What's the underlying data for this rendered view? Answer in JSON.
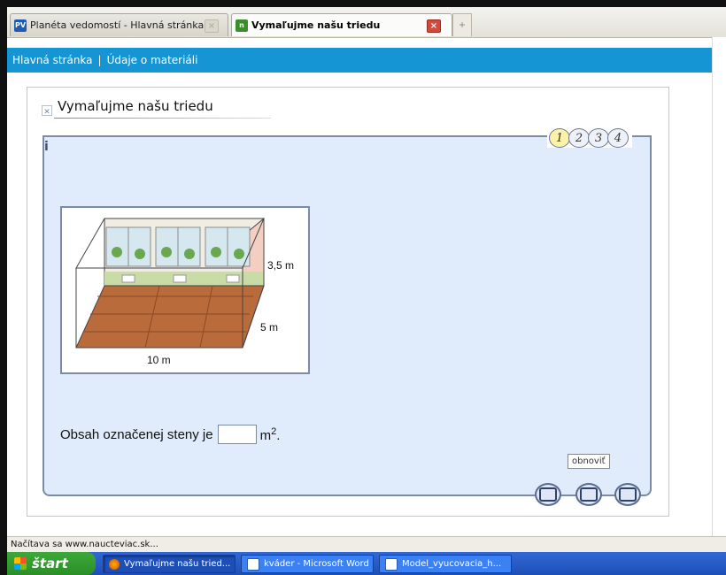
{
  "tabs": [
    {
      "favicon": "PV",
      "label": "Planéta vedomostí - Hlavná stránka",
      "close": "×"
    },
    {
      "favicon": "n",
      "label": "Vymaľujme našu triedu",
      "close": "×"
    }
  ],
  "new_tab": "+",
  "nav": {
    "home": "Hlavná stránka",
    "separator": "|",
    "details": "Údaje o materiáli"
  },
  "card": {
    "title": "Vymaľujme našu triedu",
    "info": "i"
  },
  "steps": [
    "1",
    "2",
    "3",
    "4"
  ],
  "active_step": 1,
  "illustration": {
    "height_label": "3,5 m",
    "depth_label": "5 m",
    "width_label": "10 m"
  },
  "question": {
    "text": "Obsah označenej steny je",
    "unit": "m",
    "exponent": "2",
    "period": ".",
    "answer": ""
  },
  "tooltip": "obnoviť",
  "controls": [
    "help-icon",
    "refresh-icon",
    "check-icon"
  ],
  "status": "Načítava sa www.naucteviac.sk...",
  "taskbar": {
    "start": "štart",
    "items": [
      {
        "label": "Vymaľujme našu tried...",
        "icon": "firefox-icon",
        "active": true
      },
      {
        "label": "kváder - Microsoft Word",
        "icon": "word-icon",
        "active": false
      },
      {
        "label": "Model_vyucovacia_h...",
        "icon": "word-icon",
        "active": false
      }
    ]
  },
  "colors": {
    "nav": "#1595d3",
    "panel": "#e0ebfb",
    "panel_border": "#7b8aa6",
    "taskbar": "#1e4fb7",
    "start": "#2a8f27"
  }
}
